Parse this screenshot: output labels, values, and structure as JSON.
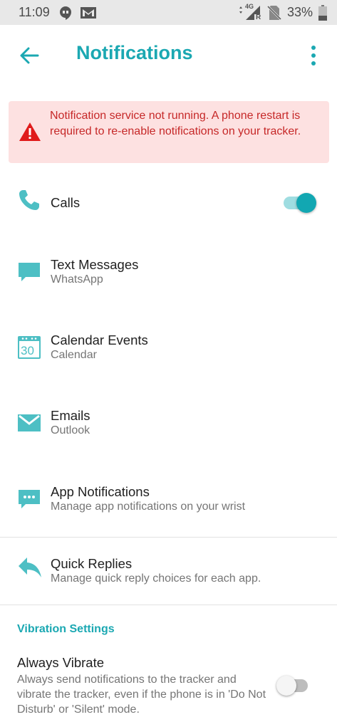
{
  "status_bar": {
    "time": "11:09",
    "network": "4G",
    "roaming": "R",
    "battery": "33%",
    "icons": [
      "hangouts-icon",
      "gmail-icon",
      "signal-icon",
      "no-sim-icon",
      "battery-icon"
    ]
  },
  "app_bar": {
    "title": "Notifications",
    "back_icon": "arrow-back-icon",
    "more_icon": "more-vert-icon"
  },
  "alert": {
    "message": "Notification service not running. A phone restart is required to re-enable notifications on your tracker.",
    "icon": "warning-icon"
  },
  "items": [
    {
      "label": "Calls",
      "subtitle": "",
      "icon": "phone-icon",
      "toggle": true
    },
    {
      "label": "Text Messages",
      "subtitle": "WhatsApp",
      "icon": "message-icon"
    },
    {
      "label": "Calendar Events",
      "subtitle": "Calendar",
      "icon": "calendar-icon",
      "icon_text": "30"
    },
    {
      "label": "Emails",
      "subtitle": "Outlook",
      "icon": "email-icon"
    },
    {
      "label": "App Notifications",
      "subtitle": "Manage app notifications on your wrist",
      "icon": "app-notification-icon"
    },
    {
      "label": "Quick Replies",
      "subtitle": "Manage quick reply choices for each app.",
      "icon": "reply-icon"
    }
  ],
  "vibration": {
    "section_title": "Vibration Settings",
    "always_vibrate_title": "Always Vibrate",
    "always_vibrate_desc": "Always send notifications to the tracker and vibrate the tracker, even if the phone is in 'Do Not Disturb' or 'Silent' mode.",
    "toggle": false
  },
  "colors": {
    "accent": "#1ba8b2",
    "icon": "#4dbfc4",
    "alert_bg": "#fde1e1",
    "alert_text": "#c62828",
    "warning_red": "#e01b1b"
  }
}
